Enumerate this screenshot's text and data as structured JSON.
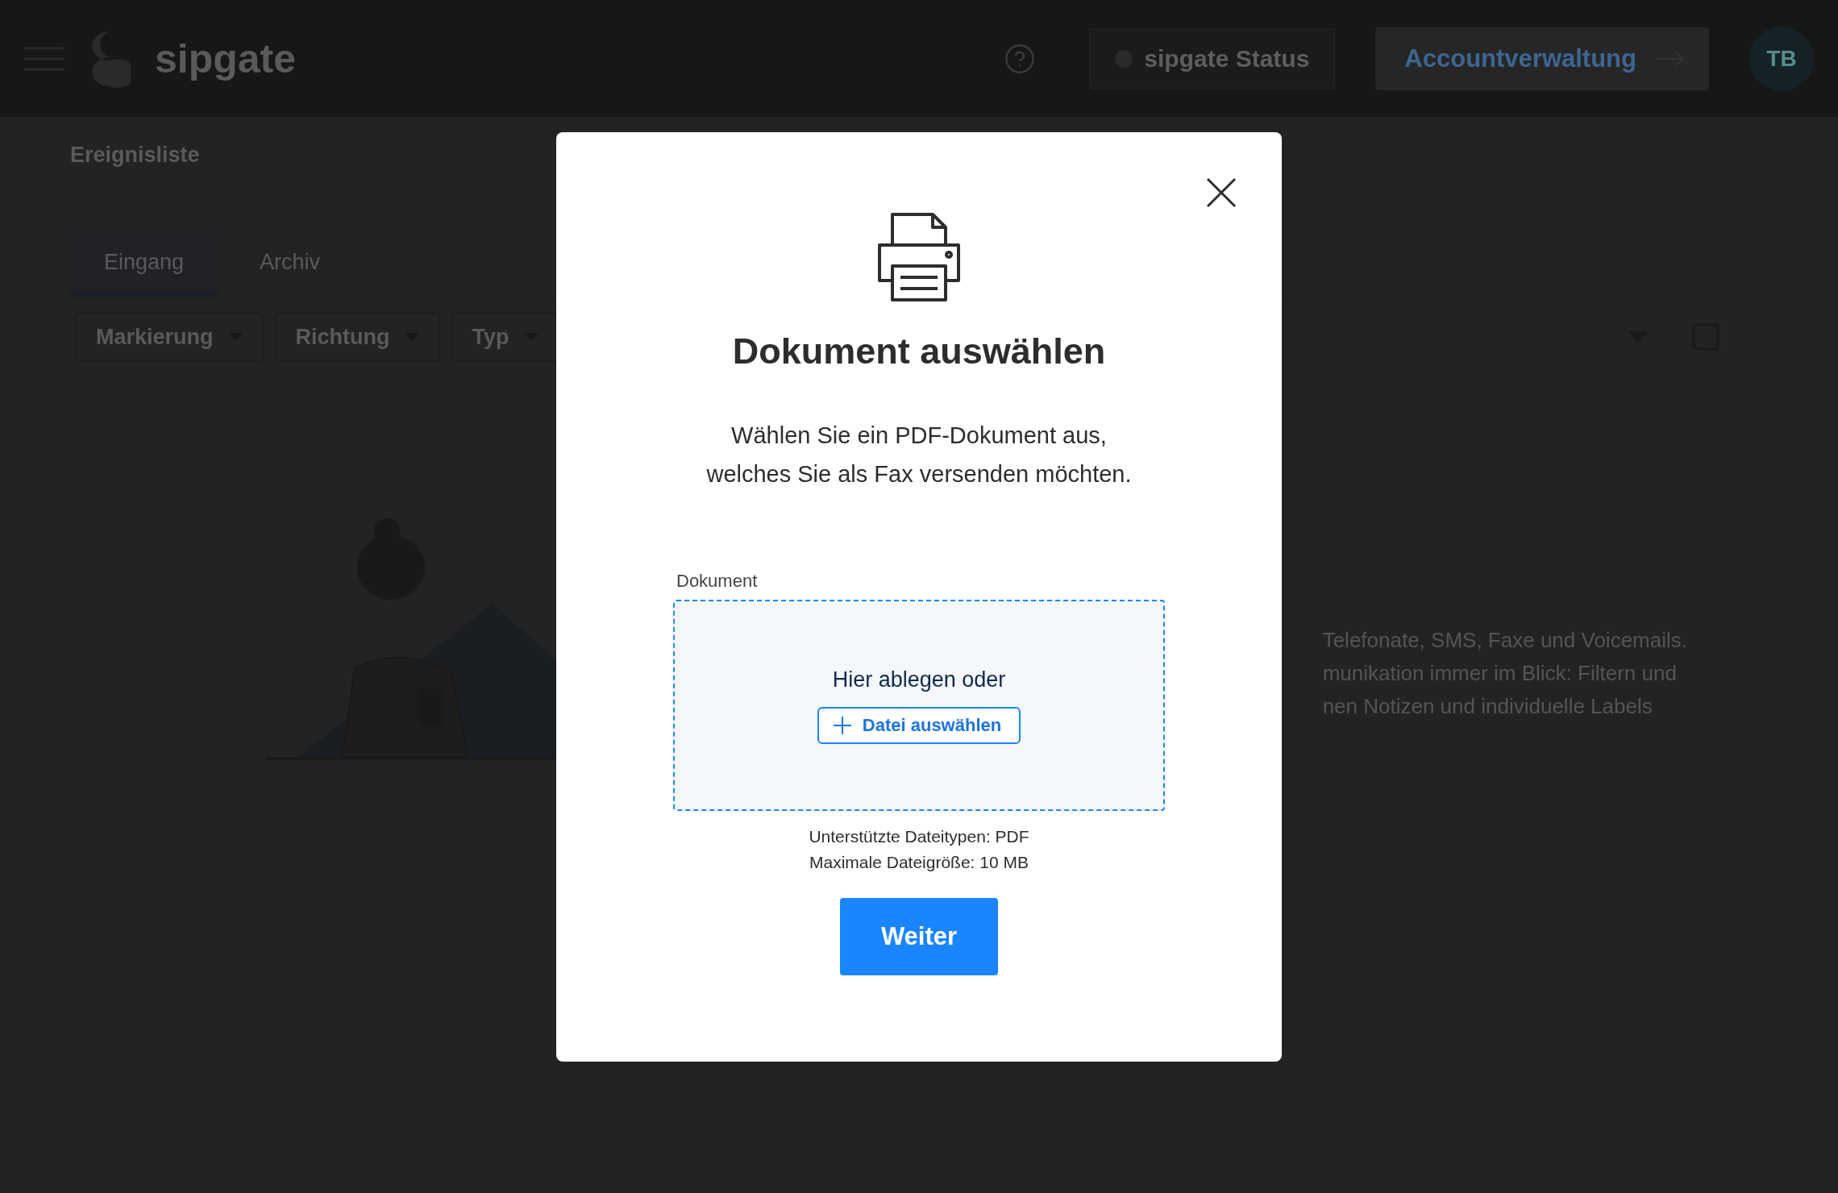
{
  "header": {
    "logo": "sipgate",
    "status_button": "sipgate Status",
    "account_button": "Accountverwaltung",
    "avatar": "TB"
  },
  "page_title": "Ereignisliste",
  "tabs": [
    {
      "label": "Eingang",
      "selected": true
    },
    {
      "label": "Archiv",
      "selected": false
    }
  ],
  "filters": [
    "Markierung",
    "Richtung",
    "Typ"
  ],
  "select_all": {
    "checked": false
  },
  "empty_state": {
    "lines": [
      "Telefonate, SMS, Faxe und Voicemails.",
      "munikation immer im Blick: Filtern und",
      "nen Notizen und individuelle Labels"
    ]
  },
  "dialog": {
    "title": "Dokument auswählen",
    "description": "Wählen Sie ein PDF-Dokument aus,\nwelches Sie als Fax versenden möchten.",
    "field_label": "Dokument",
    "drop_text": "Hier ablegen oder",
    "choose_button": "Datei auswählen",
    "hints": [
      "Unterstützte Dateitypen: PDF",
      "Maximale Dateigröße: 10 MB"
    ],
    "submit_button": "Weiter"
  }
}
